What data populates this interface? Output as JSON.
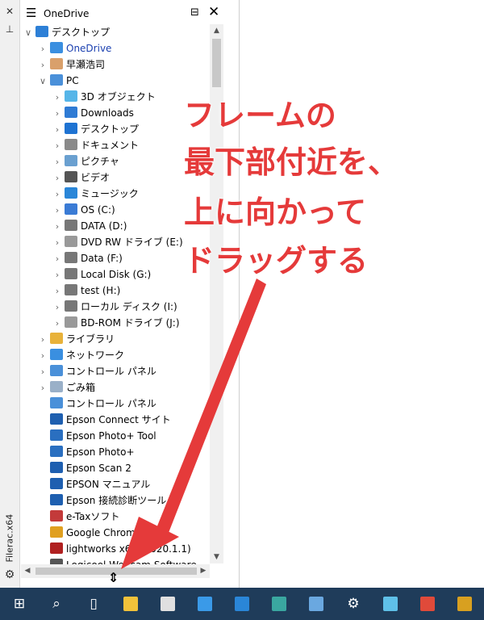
{
  "app": {
    "vertical_title": "Filerac.x64"
  },
  "pane": {
    "title": "OneDrive"
  },
  "tree": [
    {
      "label": "デスクトップ",
      "depth": 0,
      "exp": "open",
      "color": "#2d7fd6",
      "sel": false
    },
    {
      "label": "OneDrive",
      "depth": 1,
      "exp": "closed",
      "color": "#3a8fe0",
      "sel": true
    },
    {
      "label": "早瀬浩司",
      "depth": 1,
      "exp": "closed",
      "color": "#d9a06b",
      "sel": false
    },
    {
      "label": "PC",
      "depth": 1,
      "exp": "open",
      "color": "#4a90d9",
      "sel": false
    },
    {
      "label": "3D オブジェクト",
      "depth": 2,
      "exp": "closed",
      "color": "#56b5e8",
      "sel": false
    },
    {
      "label": "Downloads",
      "depth": 2,
      "exp": "closed",
      "color": "#2f7bd4",
      "sel": false
    },
    {
      "label": "デスクトップ",
      "depth": 2,
      "exp": "closed",
      "color": "#1e73d2",
      "sel": false
    },
    {
      "label": "ドキュメント",
      "depth": 2,
      "exp": "closed",
      "color": "#8a8a8a",
      "sel": false
    },
    {
      "label": "ピクチャ",
      "depth": 2,
      "exp": "closed",
      "color": "#6aa0d0",
      "sel": false
    },
    {
      "label": "ビデオ",
      "depth": 2,
      "exp": "closed",
      "color": "#555555",
      "sel": false
    },
    {
      "label": "ミュージック",
      "depth": 2,
      "exp": "closed",
      "color": "#2a86d8",
      "sel": false
    },
    {
      "label": "OS (C:)",
      "depth": 2,
      "exp": "closed",
      "color": "#3a7bd5",
      "sel": false
    },
    {
      "label": "DATA (D:)",
      "depth": 2,
      "exp": "closed",
      "color": "#777777",
      "sel": false
    },
    {
      "label": "DVD RW ドライブ (E:)",
      "depth": 2,
      "exp": "closed",
      "color": "#999999",
      "sel": false
    },
    {
      "label": "Data (F:)",
      "depth": 2,
      "exp": "closed",
      "color": "#777777",
      "sel": false
    },
    {
      "label": "Local Disk (G:)",
      "depth": 2,
      "exp": "closed",
      "color": "#777777",
      "sel": false
    },
    {
      "label": "test (H:)",
      "depth": 2,
      "exp": "closed",
      "color": "#777777",
      "sel": false
    },
    {
      "label": "ローカル ディスク (I:)",
      "depth": 2,
      "exp": "closed",
      "color": "#777777",
      "sel": false
    },
    {
      "label": "BD-ROM ドライブ (J:)",
      "depth": 2,
      "exp": "closed",
      "color": "#999999",
      "sel": false
    },
    {
      "label": "ライブラリ",
      "depth": 1,
      "exp": "closed",
      "color": "#e8b23a",
      "sel": false
    },
    {
      "label": "ネットワーク",
      "depth": 1,
      "exp": "closed",
      "color": "#3a8fe0",
      "sel": false
    },
    {
      "label": "コントロール パネル",
      "depth": 1,
      "exp": "closed",
      "color": "#4a90d9",
      "sel": false
    },
    {
      "label": "ごみ箱",
      "depth": 1,
      "exp": "closed",
      "color": "#9ab0c8",
      "sel": false
    },
    {
      "label": "コントロール パネル",
      "depth": 1,
      "exp": "none",
      "color": "#4a90d9",
      "sel": false
    },
    {
      "label": "Epson Connect サイト",
      "depth": 1,
      "exp": "none",
      "color": "#1e5fb0",
      "sel": false
    },
    {
      "label": "Epson Photo+ Tool",
      "depth": 1,
      "exp": "none",
      "color": "#2a6fc0",
      "sel": false
    },
    {
      "label": "Epson Photo+",
      "depth": 1,
      "exp": "none",
      "color": "#2a6fc0",
      "sel": false
    },
    {
      "label": "Epson Scan 2",
      "depth": 1,
      "exp": "none",
      "color": "#1e5fb0",
      "sel": false
    },
    {
      "label": "EPSON マニュアル",
      "depth": 1,
      "exp": "none",
      "color": "#1e5fb0",
      "sel": false
    },
    {
      "label": "Epson 接続診断ツール",
      "depth": 1,
      "exp": "none",
      "color": "#1e5fb0",
      "sel": false
    },
    {
      "label": "e-Taxソフト",
      "depth": 1,
      "exp": "none",
      "color": "#c33a3a",
      "sel": false
    },
    {
      "label": "Google Chrome",
      "depth": 1,
      "exp": "none",
      "color": "#e0a020",
      "sel": false
    },
    {
      "label": "lightworks x64 (2020.1.1)",
      "depth": 1,
      "exp": "none",
      "color": "#b02020",
      "sel": false
    },
    {
      "label": "Logicool Webcam Software",
      "depth": 1,
      "exp": "none",
      "color": "#555555",
      "sel": false
    }
  ],
  "annotation": {
    "lines": [
      "フレームの",
      "最下部付近を、",
      "上に向かって",
      "ドラッグする"
    ],
    "color": "#e53a3a"
  },
  "icons": {
    "side_close": "close-icon",
    "side_pin": "pin-icon",
    "side_settings": "gear-icon",
    "header_menu": "hamburger-icon",
    "header_max": "maximize-icon",
    "header_close": "close-icon",
    "resize_cursor": "resize-vertical-icon"
  },
  "taskbar": [
    {
      "name": "start-button",
      "glyph": "⊞",
      "color": ""
    },
    {
      "name": "search-button",
      "glyph": "⌕",
      "color": ""
    },
    {
      "name": "task-view-button",
      "glyph": "▯",
      "color": ""
    },
    {
      "name": "file-explorer-app",
      "glyph": "",
      "color": "#f2c23a"
    },
    {
      "name": "store-app",
      "glyph": "",
      "color": "#e0e0e0"
    },
    {
      "name": "phone-app",
      "glyph": "",
      "color": "#3a9ae8"
    },
    {
      "name": "mail-app",
      "glyph": "",
      "color": "#2a86d8"
    },
    {
      "name": "edge-app",
      "glyph": "",
      "color": "#3aa7a0"
    },
    {
      "name": "control-app",
      "glyph": "",
      "color": "#6aa8e0"
    },
    {
      "name": "settings-app",
      "glyph": "⚙",
      "color": ""
    },
    {
      "name": "recycle-app",
      "glyph": "",
      "color": "#5fc0e8"
    },
    {
      "name": "chrome-app",
      "glyph": "",
      "color": "#e04a3a"
    },
    {
      "name": "game-app",
      "glyph": "",
      "color": "#d8a020"
    }
  ]
}
